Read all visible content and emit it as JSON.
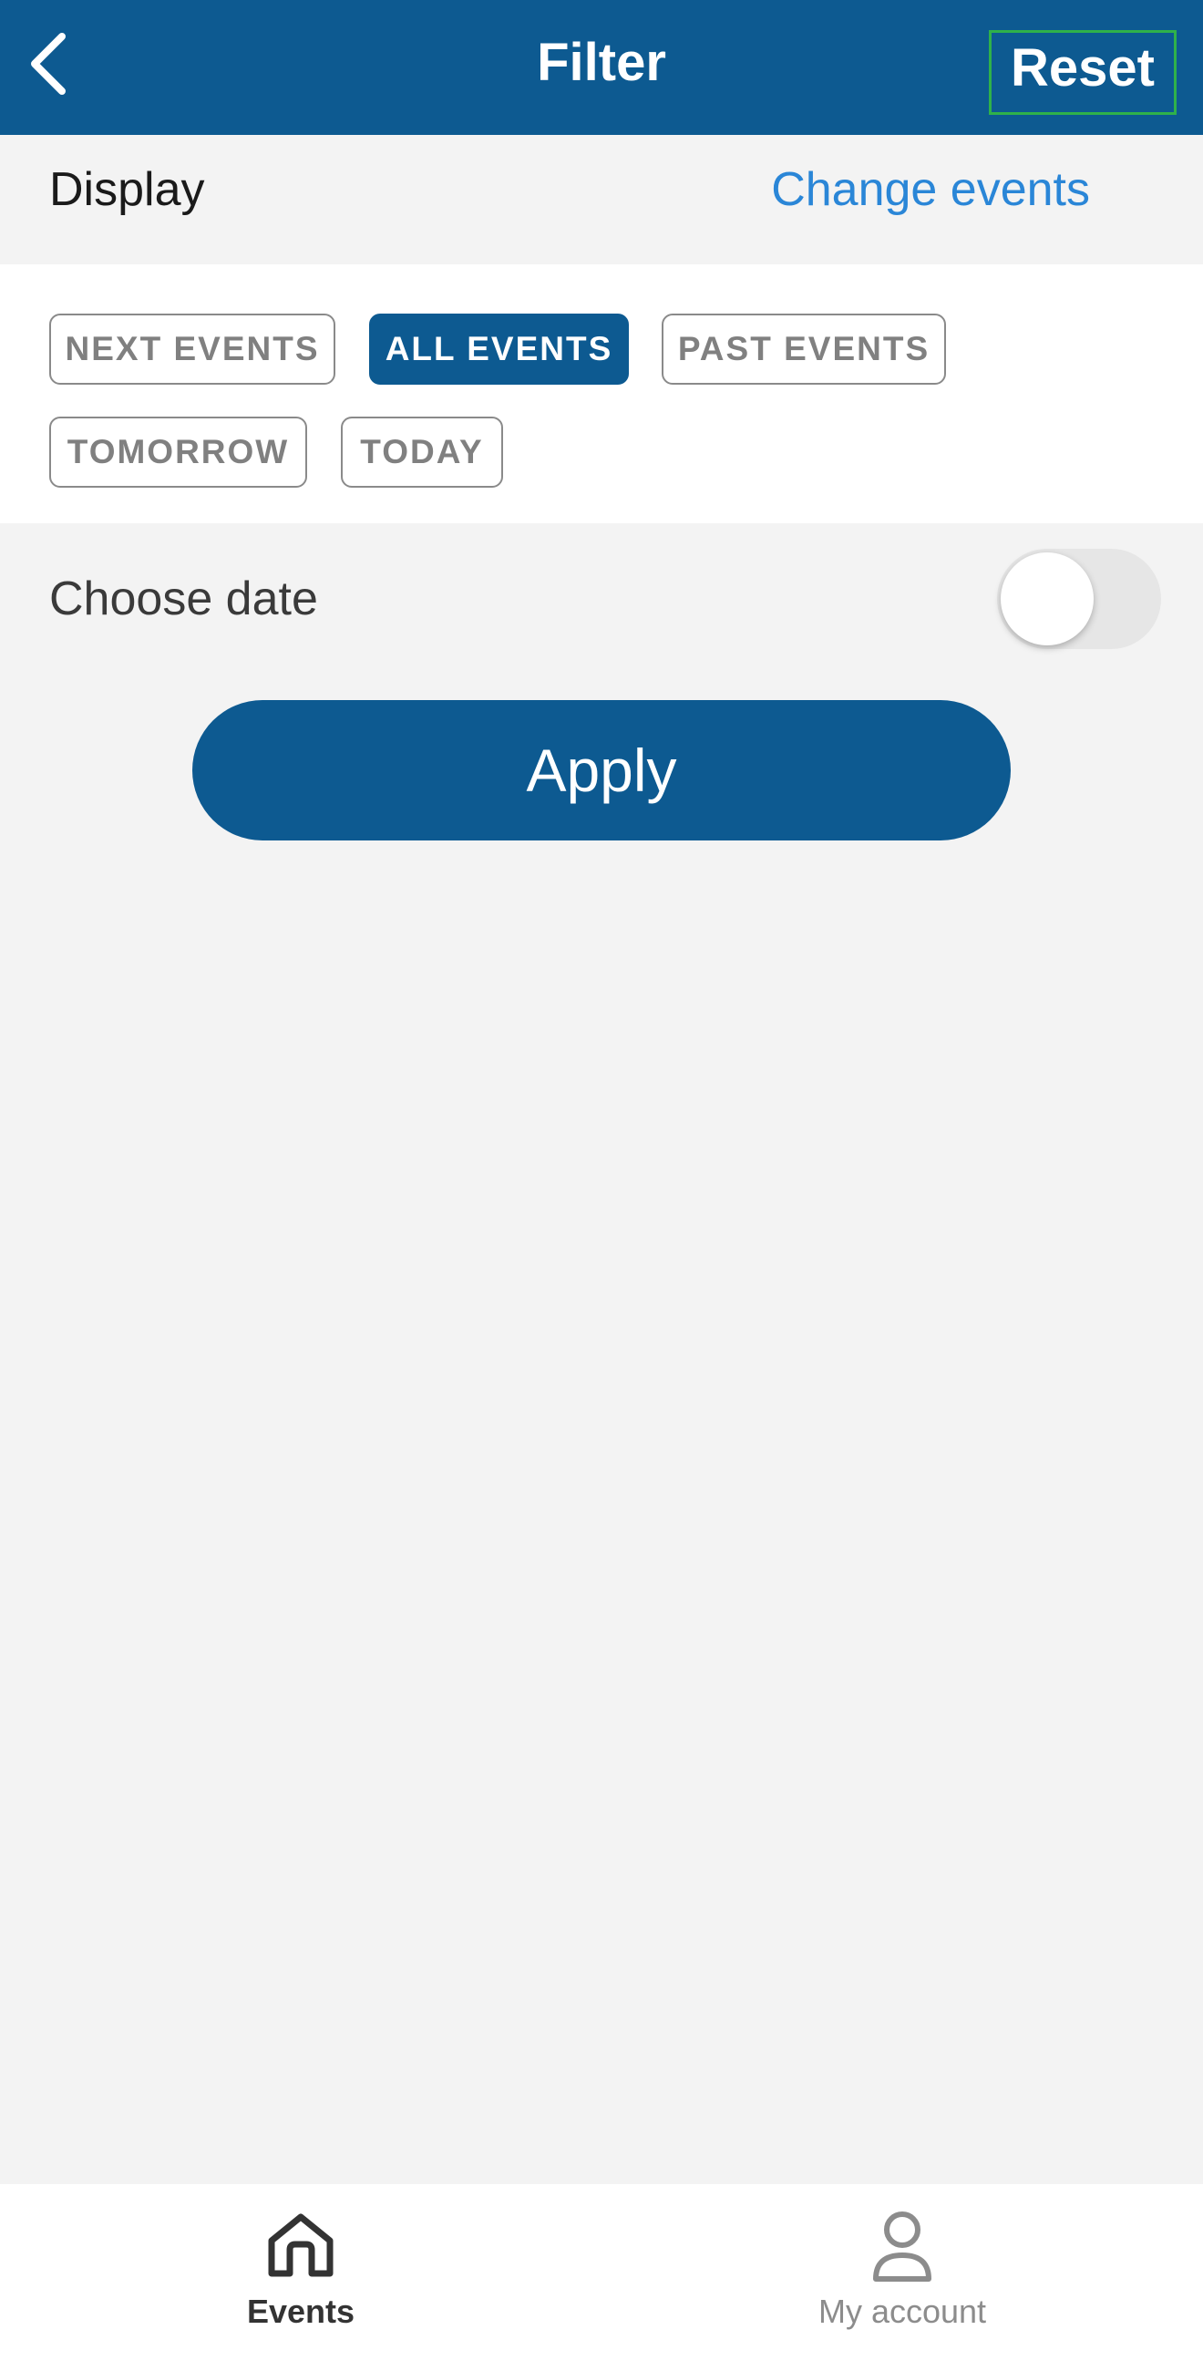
{
  "header": {
    "title": "Filter",
    "reset_label": "Reset"
  },
  "display": {
    "label": "Display",
    "change_events_label": "Change events"
  },
  "chips": [
    {
      "label": "NEXT EVENTS",
      "selected": false
    },
    {
      "label": "ALL EVENTS",
      "selected": true
    },
    {
      "label": "PAST EVENTS",
      "selected": false
    },
    {
      "label": "TOMORROW",
      "selected": false
    },
    {
      "label": "TODAY",
      "selected": false
    }
  ],
  "choose_date": {
    "label": "Choose date",
    "enabled": false
  },
  "apply_label": "Apply",
  "tabs": [
    {
      "label": "Events",
      "icon": "home-icon",
      "active": true
    },
    {
      "label": "My account",
      "icon": "user-icon",
      "active": false
    }
  ],
  "colors": {
    "primary": "#0d5a91",
    "link": "#2a86d7",
    "highlight_border": "#2fb14a",
    "background": "#f3f3f3"
  }
}
